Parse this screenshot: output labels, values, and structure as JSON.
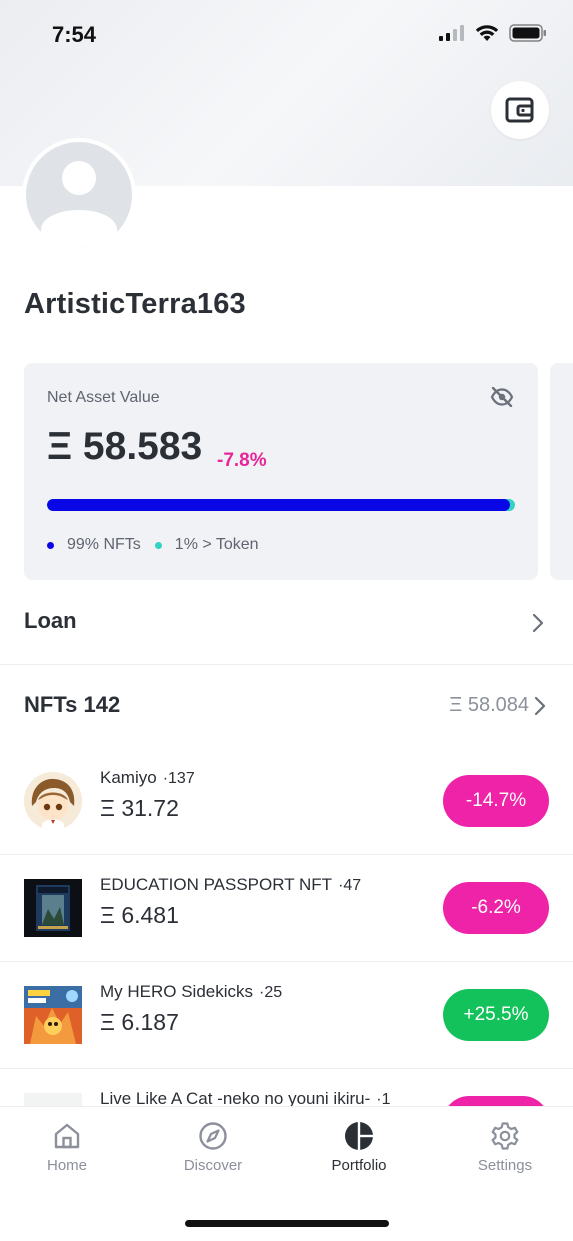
{
  "status_bar": {
    "time": "7:54"
  },
  "profile": {
    "username": "ArtisticTerra163"
  },
  "net_asset": {
    "label": "Net Asset Value",
    "value": "Ξ 58.583",
    "change": "-7.8%",
    "nft_share": 0.99,
    "nft_legend": "99% NFTs",
    "token_legend": "1% > Token",
    "colors": {
      "nft": "#0a07e6",
      "token": "#32d3c4",
      "negative": "#e8259a"
    }
  },
  "loan": {
    "label": "Loan"
  },
  "nfts": {
    "heading": "NFTs 142",
    "total": "Ξ 58.084",
    "items": [
      {
        "name": "Kamiyo",
        "count": "·137",
        "value": "Ξ 31.72",
        "change": "-14.7%",
        "trend": "down"
      },
      {
        "name": "EDUCATION PASSPORT NFT",
        "count": "·47",
        "value": "Ξ 6.481",
        "change": "-6.2%",
        "trend": "down"
      },
      {
        "name": "My HERO Sidekicks",
        "count": "·25",
        "value": "Ξ 6.187",
        "change": "+25.5%",
        "trend": "up"
      },
      {
        "name": "Live Like A Cat -neko no youni ikiru-",
        "count": "·1",
        "value": "",
        "change": "",
        "trend": "down"
      }
    ],
    "colors": {
      "down": "#ee23a8",
      "up": "#13c25a"
    }
  },
  "tabbar": {
    "tabs": [
      {
        "label": "Home",
        "icon": "home-icon"
      },
      {
        "label": "Discover",
        "icon": "compass-icon"
      },
      {
        "label": "Portfolio",
        "icon": "portfolio-icon",
        "active": true
      },
      {
        "label": "Settings",
        "icon": "gear-icon"
      }
    ]
  }
}
